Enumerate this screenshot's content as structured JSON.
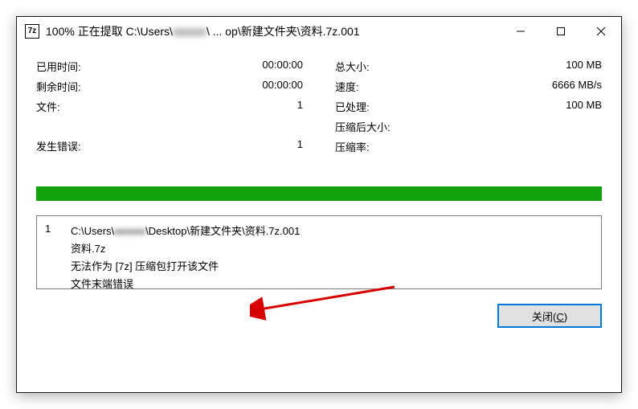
{
  "title": {
    "prefix": "100% 正在提取 C:\\Users\\",
    "redacted": "xxxxxx",
    "suffix": "\\ ... op\\新建文件夹\\资料.7z.001"
  },
  "icon_label": "7z",
  "stats": {
    "left": {
      "elapsed_label": "已用时间:",
      "elapsed_value": "00:00:00",
      "remaining_label": "剩余时间:",
      "remaining_value": "00:00:00",
      "files_label": "文件:",
      "files_value": "1",
      "errors_label": "发生错误:",
      "errors_value": "1"
    },
    "right": {
      "total_size_label": "总大小:",
      "total_size_value": "100 MB",
      "speed_label": "速度:",
      "speed_value": "6666 MB/s",
      "processed_label": "已处理:",
      "processed_value": "100 MB",
      "compressed_size_label": "压缩后大小:",
      "compressed_size_value": "",
      "ratio_label": "压缩率:",
      "ratio_value": ""
    }
  },
  "progress_percent": 100,
  "error": {
    "index": "1",
    "line1_prefix": "C:\\Users\\",
    "line1_redacted": "xxxxxx",
    "line1_suffix": "\\Desktop\\新建文件夹\\资料.7z.001",
    "line2": "资料.7z",
    "line3": "无法作为 [7z] 压缩包打开该文件",
    "line4": "文件末端错误"
  },
  "close_button_label": "关闭",
  "close_button_accel": "C"
}
